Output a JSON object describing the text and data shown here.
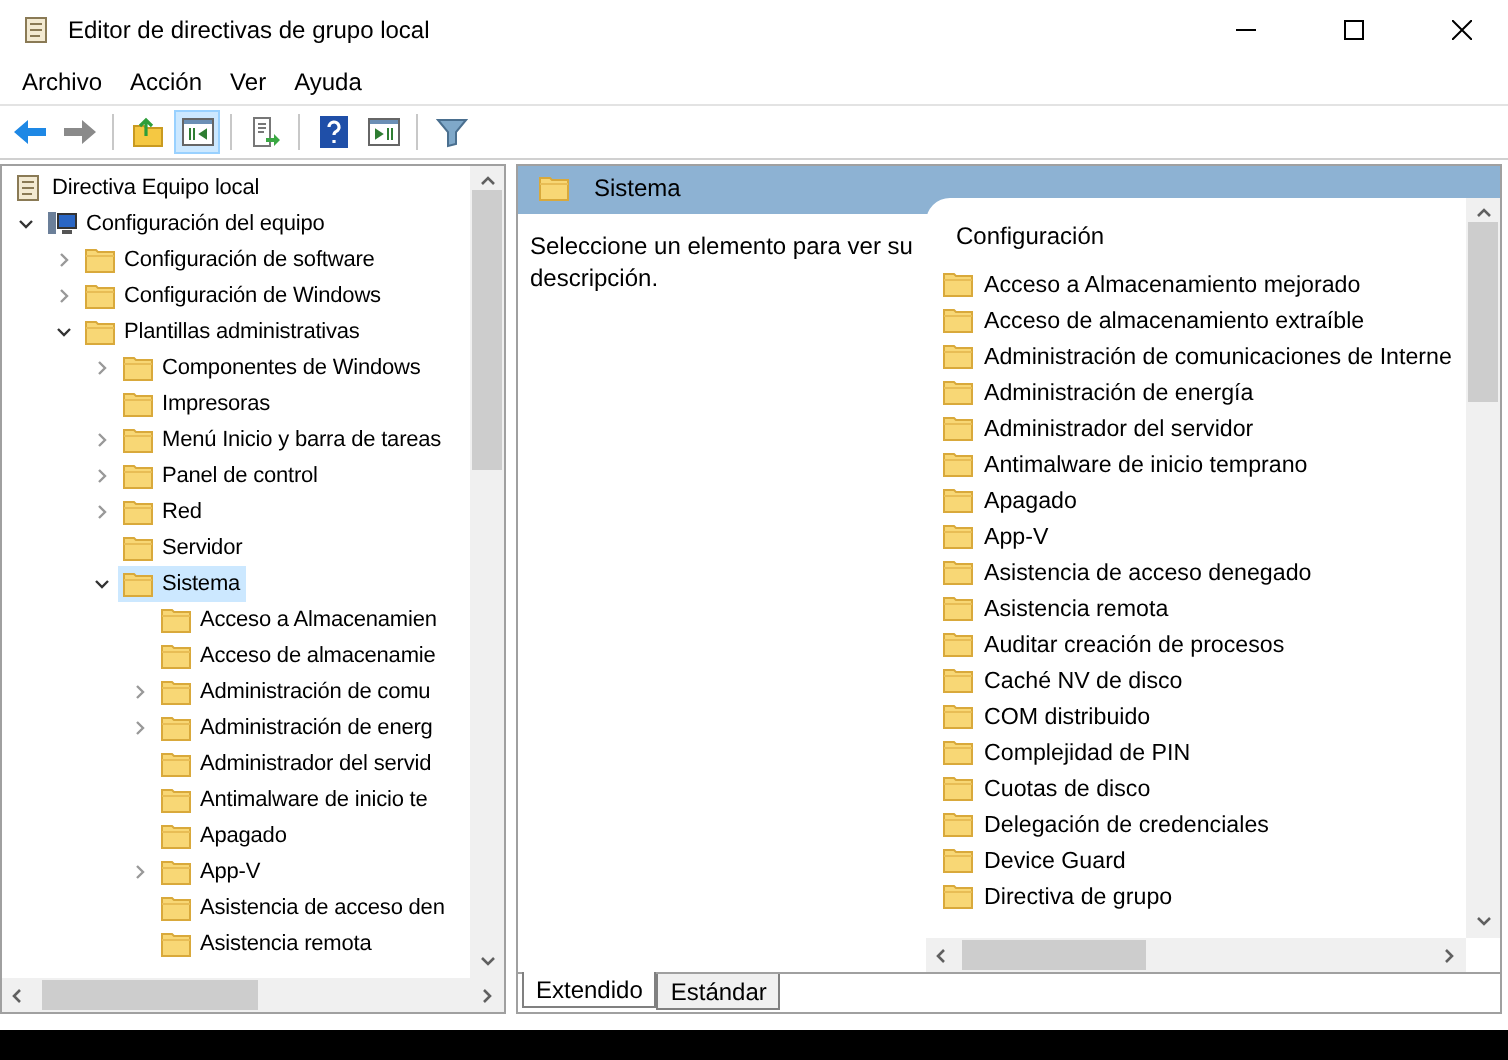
{
  "window": {
    "title": "Editor de directivas de grupo local"
  },
  "menu": [
    "Archivo",
    "Acción",
    "Ver",
    "Ayuda"
  ],
  "toolbar": [
    {
      "kind": "back",
      "pressed": false
    },
    {
      "kind": "forward",
      "pressed": false
    },
    {
      "kind": "sep"
    },
    {
      "kind": "up",
      "pressed": false
    },
    {
      "kind": "tree",
      "pressed": true
    },
    {
      "kind": "sep"
    },
    {
      "kind": "export",
      "pressed": false
    },
    {
      "kind": "sep"
    },
    {
      "kind": "help",
      "pressed": false
    },
    {
      "kind": "pane",
      "pressed": false
    },
    {
      "kind": "sep"
    },
    {
      "kind": "filter",
      "pressed": false
    }
  ],
  "tree": [
    {
      "label": "Directiva Equipo local",
      "selected": false,
      "children": [
        {
          "label": "Configuración del equipo",
          "kind": "branch",
          "expanded": true,
          "selected": false,
          "children": [
            {
              "label": "Configuración de software",
              "kind": "branch",
              "expanded": false,
              "selected": false
            },
            {
              "label": "Configuración de Windows",
              "kind": "branch",
              "expanded": false,
              "selected": false
            },
            {
              "label": "Plantillas administrativas",
              "kind": "branch",
              "expanded": true,
              "selected": false,
              "children": [
                {
                  "label": "Componentes de Windows",
                  "kind": "branch",
                  "expanded": false,
                  "selected": false
                },
                {
                  "label": "Impresoras",
                  "kind": "leaf",
                  "selected": false
                },
                {
                  "label": "Menú Inicio y barra de tareas",
                  "kind": "branch",
                  "expanded": false,
                  "selected": false
                },
                {
                  "label": "Panel de control",
                  "kind": "branch",
                  "expanded": false,
                  "selected": false
                },
                {
                  "label": "Red",
                  "kind": "branch",
                  "expanded": false,
                  "selected": false
                },
                {
                  "label": "Servidor",
                  "kind": "leaf",
                  "selected": false
                },
                {
                  "label": "Sistema",
                  "kind": "branch",
                  "expanded": true,
                  "selected": true,
                  "children": [
                    {
                      "label": "Acceso a Almacenamien",
                      "kind": "leaf",
                      "selected": false
                    },
                    {
                      "label": "Acceso de almacenamie",
                      "kind": "leaf",
                      "selected": false
                    },
                    {
                      "label": "Administración de comu",
                      "kind": "branch",
                      "expanded": false,
                      "selected": false
                    },
                    {
                      "label": "Administración de energ",
                      "kind": "branch",
                      "expanded": false,
                      "selected": false
                    },
                    {
                      "label": "Administrador del servid",
                      "kind": "leaf",
                      "selected": false
                    },
                    {
                      "label": "Antimalware de inicio te",
                      "kind": "leaf",
                      "selected": false
                    },
                    {
                      "label": "Apagado",
                      "kind": "leaf",
                      "selected": false
                    },
                    {
                      "label": "App-V",
                      "kind": "branch",
                      "expanded": false,
                      "selected": false
                    },
                    {
                      "label": "Asistencia de acceso den",
                      "kind": "leaf",
                      "selected": false
                    },
                    {
                      "label": "Asistencia remota",
                      "kind": "leaf",
                      "selected": false
                    }
                  ]
                }
              ]
            }
          ]
        }
      ]
    }
  ],
  "details": {
    "title": "Sistema",
    "description": "Seleccione un elemento para ver su descripción.",
    "column": "Configuración",
    "items": [
      "Acceso a Almacenamiento mejorado",
      "Acceso de almacenamiento extraíble",
      "Administración de comunicaciones de Interne",
      "Administración de energía",
      "Administrador del servidor",
      "Antimalware de inicio temprano",
      "Apagado",
      "App-V",
      "Asistencia de acceso denegado",
      "Asistencia remota",
      "Auditar creación de procesos",
      "Caché NV de disco",
      "COM distribuido",
      "Complejidad de PIN",
      "Cuotas de disco",
      "Delegación de credenciales",
      "Device Guard",
      "Directiva de grupo"
    ]
  },
  "tabs": [
    {
      "label": "Extendido",
      "selected": true
    },
    {
      "label": "Estándar",
      "selected": false
    }
  ]
}
